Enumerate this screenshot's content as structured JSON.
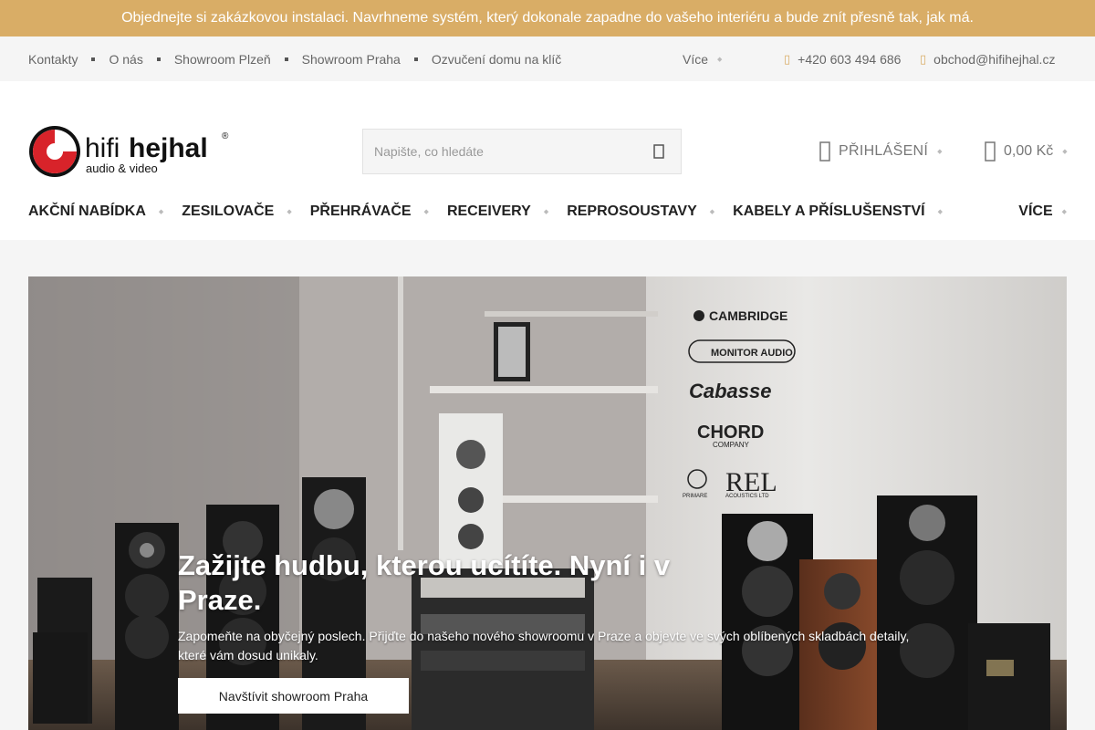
{
  "promo": {
    "text": "Objednejte si zakázkovou instalaci. Navrhneme systém, který dokonale zapadne do vašeho interiéru a bude znít přesně tak, jak má."
  },
  "topbar": {
    "links": [
      "Kontakty",
      "O nás",
      "Showroom Plzeň",
      "Showroom Praha",
      "Ozvučení domu na klíč"
    ],
    "more_label": "Více",
    "phone": "+420 603 494 686",
    "email": "obchod@hifihejhal.cz"
  },
  "header": {
    "logo": {
      "brand_light": "hifi",
      "brand_bold": "hejhal",
      "tagline": "audio & video",
      "registered": "®"
    },
    "search": {
      "placeholder": "Napište, co hledáte",
      "icon": "search-icon"
    },
    "login_label": "PŘIHLÁŠENÍ",
    "cart_total": "0,00 Kč"
  },
  "mainnav": {
    "items": [
      "AKČNÍ NABÍDKA",
      "ZESILOVAČE",
      "PŘEHRÁVAČE",
      "RECEIVERY",
      "REPROSOUSTAVY",
      "KABELY A PŘÍSLUŠENSTVÍ"
    ],
    "more_label": "VÍCE"
  },
  "hero": {
    "title": "Zažijte hudbu, kterou ucítíte. Nyní i v Praze.",
    "text": "Zapomeňte na obyčejný poslech. Přijďte do našeho nového showroomu v Praze a objevte ve svých oblíbených skladbách detaily, které vám dosud unikaly.",
    "button_label": "Navštívit showroom Praha",
    "wall_brands": [
      "CAMBRIDGE",
      "MONITOR AUDIO",
      "Cabasse",
      "CHORD",
      "COMPANY",
      "PRIMARE",
      "REL",
      "ACOUSTICS LTD"
    ]
  },
  "colors": {
    "promo_bg": "#d9ad66",
    "accent": "#d9ad66",
    "logo_red": "#d8232a"
  }
}
